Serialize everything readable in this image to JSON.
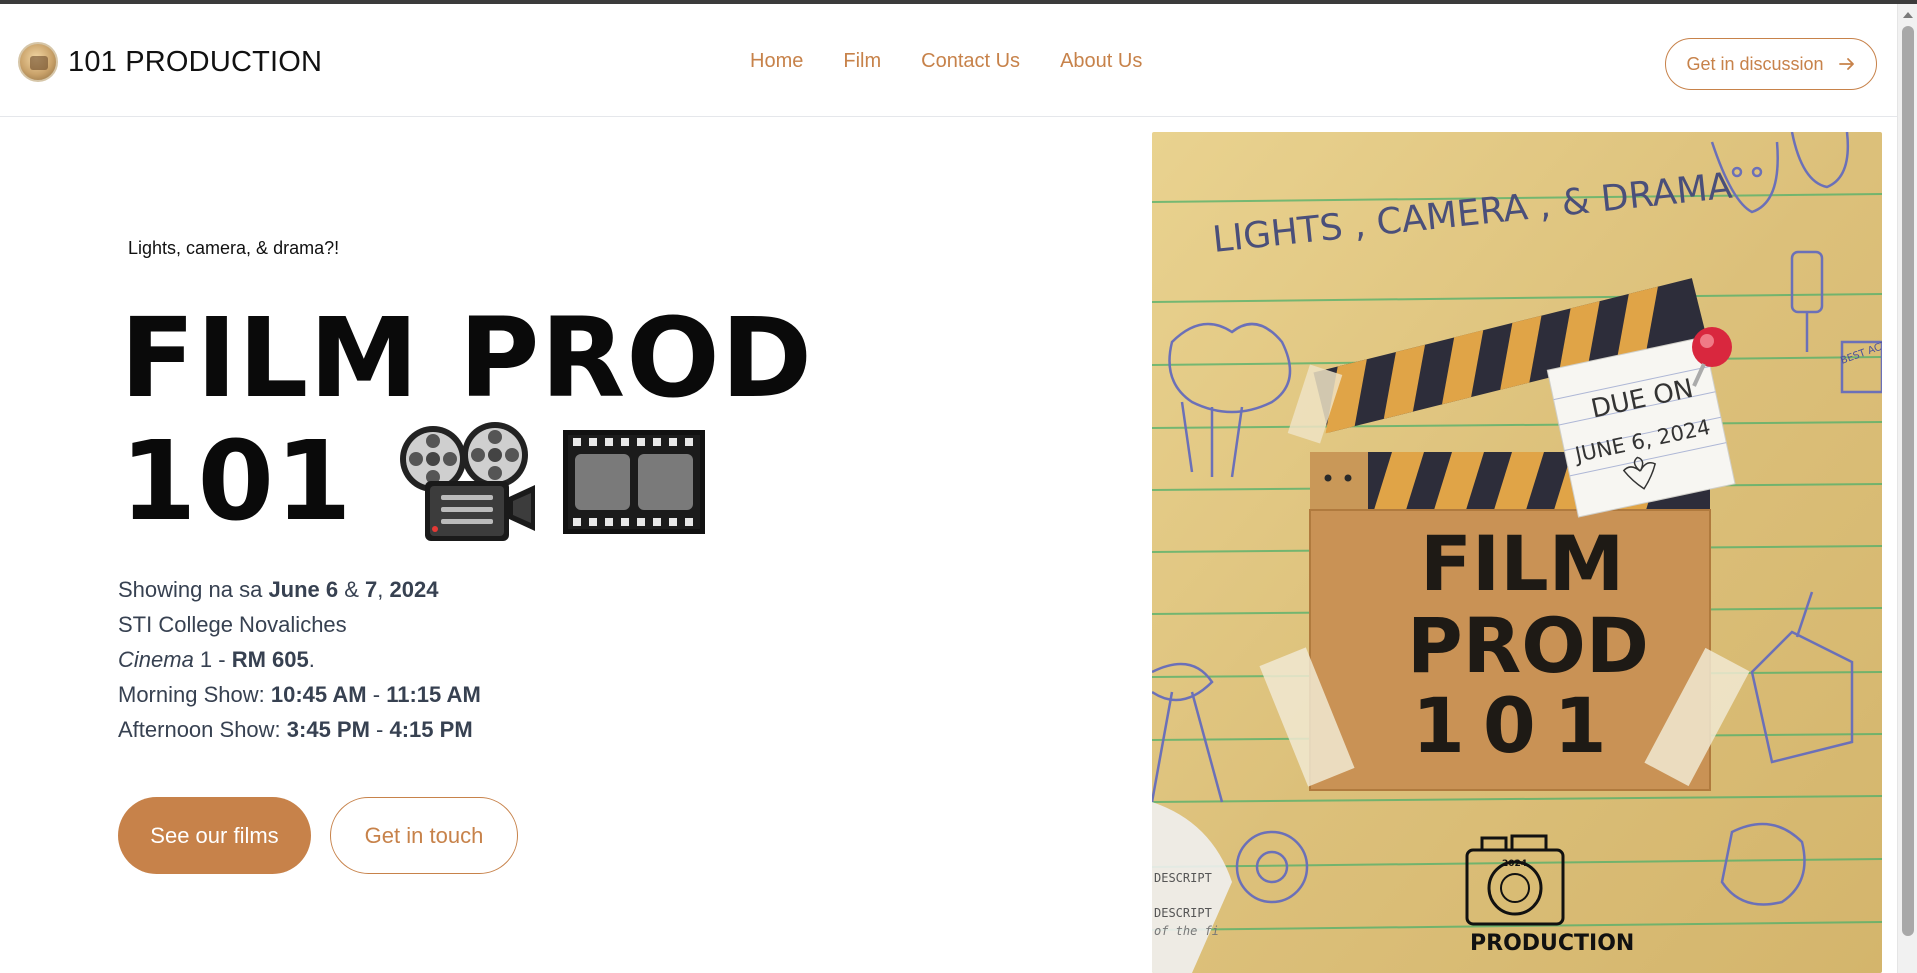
{
  "brand": {
    "name": "101 PRODUCTION",
    "logo_icon": "brand-logo"
  },
  "nav": {
    "items": [
      "Home",
      "Film",
      "Contact Us",
      "About Us"
    ]
  },
  "header_cta": {
    "label": "Get in discussion",
    "icon": "arrow-right-icon"
  },
  "hero": {
    "tagline": "Lights, camera, & drama?!",
    "title_line1": "FILM PROD",
    "title_line2": "101",
    "emojis": [
      "film-projector-icon",
      "film-frames-icon"
    ],
    "info": {
      "showing_prefix": "Showing na sa ",
      "date1": "June 6",
      "amp": " & ",
      "date2": "7",
      "comma": ", ",
      "year": "2024",
      "venue": "STI College Novaliches",
      "cinema_word": "Cinema",
      "cinema_num": " 1 - ",
      "room": "RM 605",
      "room_end": ".",
      "morning_label": "Morning Show: ",
      "morning_start": "10:45 AM",
      "dash1": " - ",
      "morning_end": "11:15 AM",
      "afternoon_label": "Afternoon Show: ",
      "afternoon_start": "3:45 PM",
      "dash2": " - ",
      "afternoon_end": "4:15 PM"
    },
    "primary_button": "See our films",
    "secondary_button": "Get in touch"
  },
  "poster": {
    "heading": "LIGHTS , CAMERA , & DRAMA",
    "note_line1": "DUE ON",
    "note_line2": "JUNE 6, 2024",
    "board_line1": "FILM",
    "board_line2": "PROD",
    "board_line3": "101",
    "logo_caption": "PRODUCTION",
    "stamp_text": "2024",
    "best_actor": "BEST ACTOR",
    "desc1": "DESCRIPT",
    "desc2": "DESCRIPT",
    "desc3": "of the fi"
  },
  "colors": {
    "accent": "#c7824a",
    "text": "#374151",
    "heading": "#0a0a0a"
  }
}
